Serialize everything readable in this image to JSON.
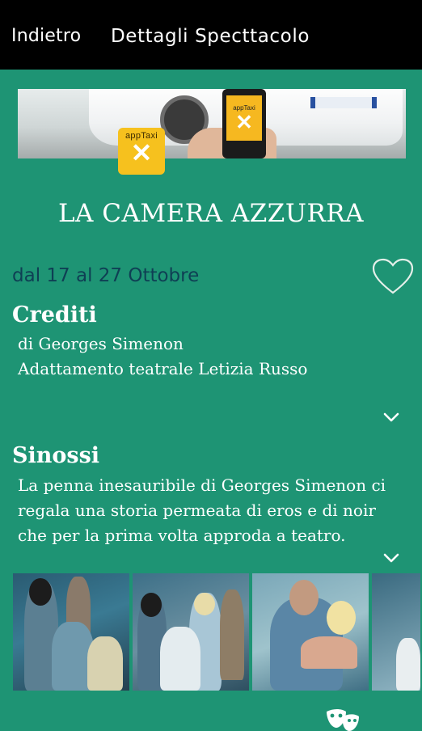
{
  "header": {
    "back_label": "Indietro",
    "title": "Dettagli Specttacolo"
  },
  "ad": {
    "brand": "appTaxi"
  },
  "show": {
    "title": "LA CAMERA AZZURRA",
    "dates": "dal 17 al 27 Ottobre"
  },
  "credits": {
    "heading": "Crediti",
    "lines": [
      "di Georges Simenon",
      "Adattamento teatrale Letizia Russo"
    ]
  },
  "synopsis": {
    "heading": "Sinossi",
    "lines": [
      "La penna inesauribile di Georges Simenon ci",
      "regala una storia permeata di eros e di noir",
      "che per la prima volta approda a teatro."
    ]
  },
  "icons": {
    "favorite": "heart-outline-icon",
    "expand": "chevron-down-icon",
    "footer": "theater-mask-icon"
  },
  "colors": {
    "background": "#1e9474",
    "topbar": "#000000",
    "dates_text": "#0f3f54",
    "ad_accent": "#f6c11e"
  }
}
